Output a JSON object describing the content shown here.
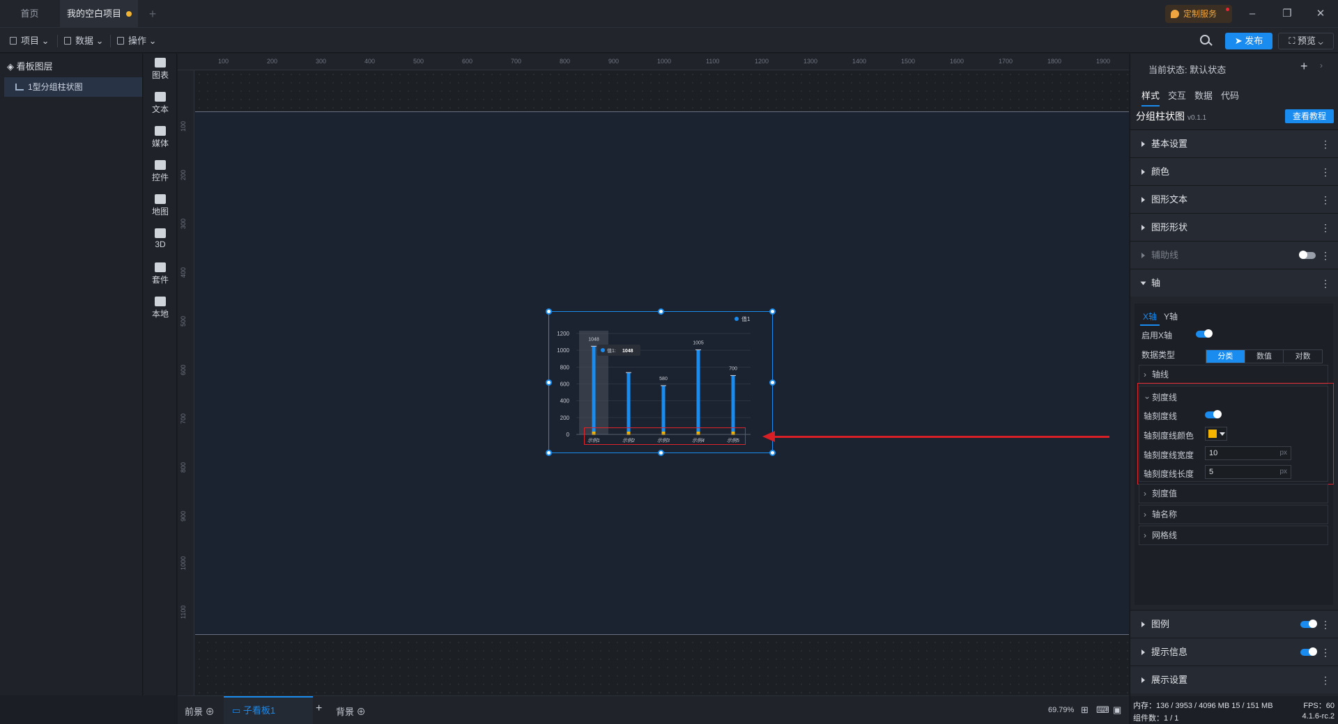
{
  "tabs": {
    "home": "首页",
    "project": "我的空白项目",
    "add": "+"
  },
  "custom_service": "定制服务",
  "window": {
    "min": "–",
    "restore": "❐",
    "close": "✕"
  },
  "toolbar": {
    "project": "项目",
    "data": "数据",
    "ops": "操作",
    "publish": "发布",
    "preview": "预览"
  },
  "layers": {
    "header": "看板图层",
    "item": "1型分组柱状图"
  },
  "components": [
    "图表",
    "文本",
    "媒体",
    "控件",
    "地图",
    "3D",
    "套件",
    "本地"
  ],
  "ruler": {
    "top": [
      "100",
      "200",
      "300",
      "400",
      "500",
      "600",
      "700",
      "800",
      "900",
      "1000",
      "1100",
      "1200",
      "1300",
      "1400",
      "1500",
      "1600",
      "1700",
      "1800",
      "1900"
    ],
    "left": [
      "100",
      "200",
      "300",
      "400",
      "500",
      "600",
      "700",
      "800",
      "900",
      "1000",
      "1100"
    ]
  },
  "chart_data": {
    "type": "bar",
    "categories": [
      "示例1",
      "示例2",
      "示例3",
      "示例4",
      "示例5"
    ],
    "series": [
      {
        "name": "值1",
        "values": [
          1048,
          735,
          580,
          1005,
          700
        ]
      }
    ],
    "data_labels": [
      "1048",
      "",
      "580",
      "1005",
      "700"
    ],
    "y_ticks": [
      "0",
      "200",
      "400",
      "600",
      "800",
      "1000",
      "1200"
    ],
    "ylim": [
      0,
      1200
    ],
    "tooltip": {
      "label": "值1:",
      "value": "1048"
    },
    "colors": {
      "bar": "#1a8cf0",
      "tick": "#f5b400",
      "hover": "#4a4f59"
    },
    "legend": "top-right"
  },
  "bottom": {
    "front": "前景",
    "board": "子看板1",
    "bg": "背景",
    "zoom": "69.79%"
  },
  "right": {
    "state_label": "当前状态:",
    "state_value": "默认状态",
    "tabs": [
      "样式",
      "交互",
      "数据",
      "代码"
    ],
    "chart_title": "分组柱状图",
    "version": "v0.1.1",
    "tutorial": "查看教程",
    "sections": [
      "基本设置",
      "颜色",
      "图形文本",
      "图形形状",
      "辅助线",
      "轴"
    ],
    "axis_tabs": [
      "X轴",
      "Y轴"
    ],
    "enable_x": "启用X轴",
    "data_type": "数据类型",
    "data_type_options": [
      "分类",
      "数值",
      "对数"
    ],
    "axis_line": "轴线",
    "tick": {
      "title": "刻度线",
      "line": "轴刻度线",
      "color": "轴刻度线颜色",
      "width": "轴刻度线宽度",
      "width_value": "10",
      "length": "轴刻度线长度",
      "length_value": "5",
      "unit": "px",
      "color_value": "#f5b400"
    },
    "tick_value": "刻度值",
    "axis_name": "轴名称",
    "grid": "网格线",
    "legend": "图例",
    "tooltip": "提示信息",
    "display": "展示设置"
  },
  "status": {
    "memory": "内存：136 / 3953 / 4096 MB 15 / 151 MB",
    "fps": "FPS：60",
    "components": "组件数：1 / 1",
    "version": "4.1.6-rc.2"
  }
}
